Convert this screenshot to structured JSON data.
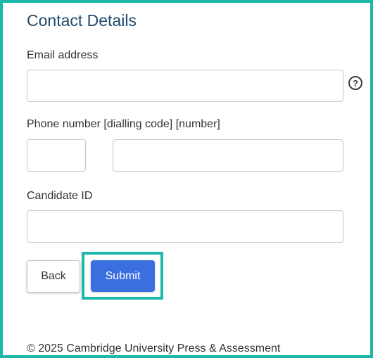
{
  "form": {
    "title": "Contact Details",
    "email": {
      "label": "Email address",
      "value": "",
      "placeholder": "",
      "help_icon": "question-circle-icon",
      "help_glyph": "?"
    },
    "phone": {
      "label": "Phone number [dialling code] [number]",
      "dialling_code_value": "",
      "number_value": ""
    },
    "candidate_id": {
      "label": "Candidate ID",
      "value": ""
    },
    "actions": {
      "back_label": "Back",
      "submit_label": "Submit"
    }
  },
  "footer": {
    "copyright": "© 2025 Cambridge University Press & Assessment"
  },
  "colors": {
    "frame_border": "#1cb8a8",
    "title": "#1f4a6e",
    "submit_bg": "#3b6fe0"
  }
}
